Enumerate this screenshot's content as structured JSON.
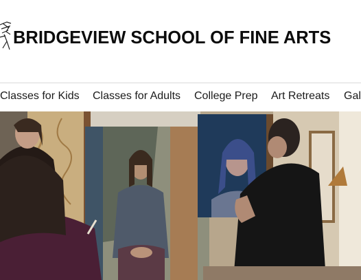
{
  "site": {
    "title": "BRIDGEVIEW SCHOOL OF FINE ARTS",
    "logo_icon": "sketch-figure-logo-icon"
  },
  "nav": {
    "items": [
      {
        "label": "Classes for Kids"
      },
      {
        "label": "Classes for Adults"
      },
      {
        "label": "College Prep"
      },
      {
        "label": "Art Retreats"
      },
      {
        "label": "Gal"
      }
    ]
  },
  "hero": {
    "kind": "photo",
    "subject": "painting-studio-scene"
  }
}
